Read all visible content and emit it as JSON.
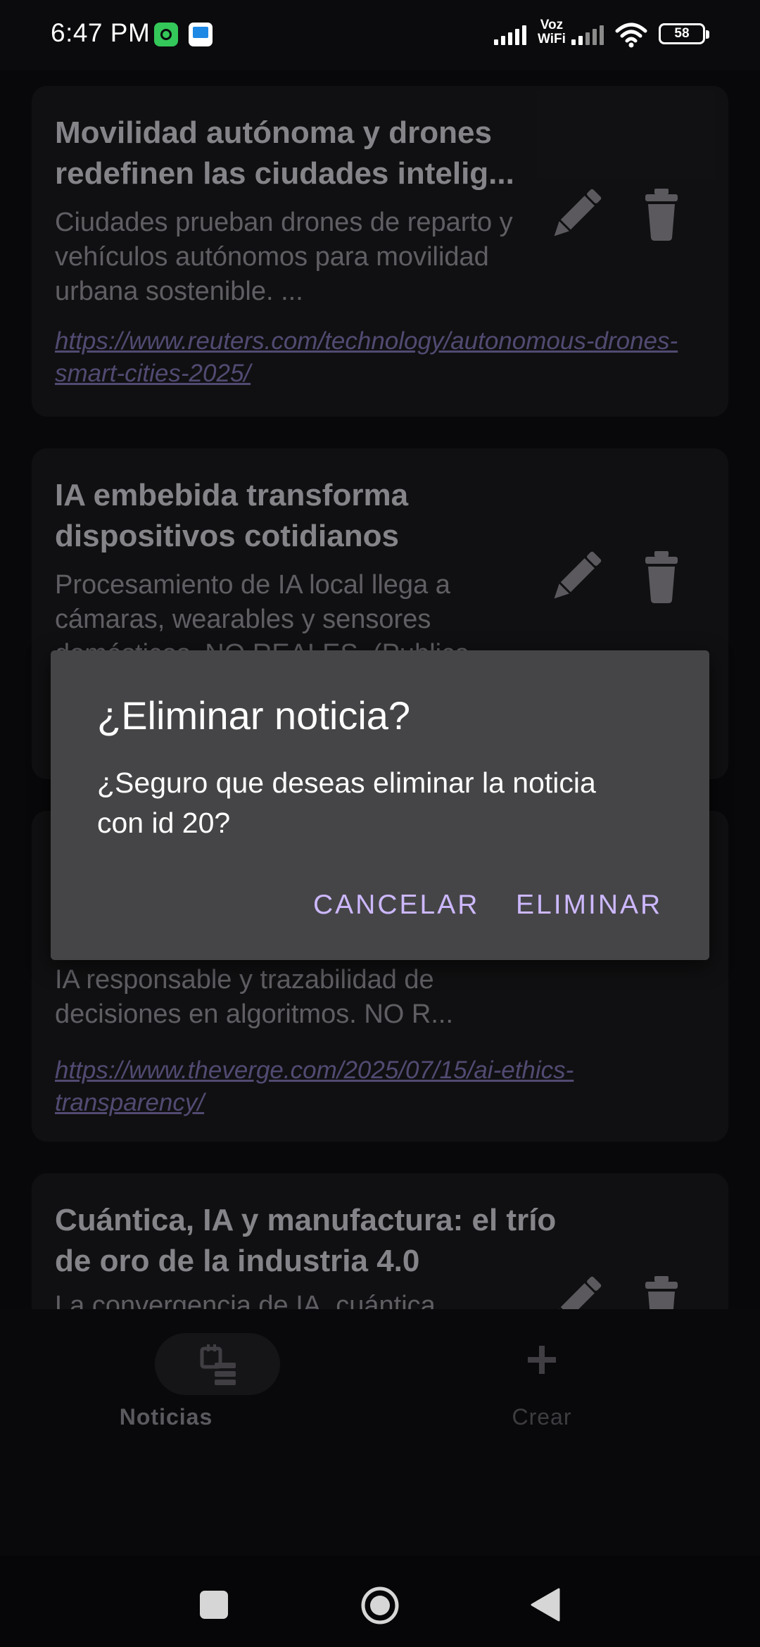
{
  "status_bar": {
    "time": "6:47 PM",
    "voz_label_top": "Voz",
    "voz_label_bottom": "WiFi",
    "battery": "58",
    "icons": [
      "android-app-icon",
      "screen-app-icon",
      "signal-icon",
      "wifi-icon",
      "battery-icon"
    ]
  },
  "news": [
    {
      "title": "Movilidad autónoma y drones redefinen las ciudades intelig...",
      "description": "Ciudades prueban drones de reparto y vehículos autónomos para movilidad urbana sostenible. ...",
      "link": "https://www.reuters.com/technology/autonomous-drones-smart-cities-2025/"
    },
    {
      "title": "IA embebida transforma dispositivos cotidianos",
      "description": "Procesamiento de IA local llega a cámaras, wearables y sensores domésticos. NO REALES. (Publica"
    },
    {
      "description": "IA responsable y trazabilidad de decisiones en algoritmos. NO R...",
      "link": "https://www.theverge.com/2025/07/15/ai-ethics-transparency/"
    },
    {
      "title": "Cuántica, IA y manufactura: el trío de oro de la industria 4.0",
      "description": "La convergencia de IA, cuántica"
    }
  ],
  "dialog": {
    "title": "¿Eliminar noticia?",
    "message": "¿Seguro que deseas eliminar la noticia con id 20?",
    "cancel_label": "CANCELAR",
    "confirm_label": "ELIMINAR"
  },
  "bottom_nav": {
    "items": [
      {
        "label": "Noticias",
        "icon": "news-list-icon",
        "active": true
      },
      {
        "label": "Crear",
        "icon": "plus-icon",
        "active": false
      }
    ]
  },
  "colors": {
    "accent": "#cdb8ff",
    "link": "#8d80c4",
    "card_bg": "#1d1c20",
    "dialog_bg": "#454547"
  }
}
